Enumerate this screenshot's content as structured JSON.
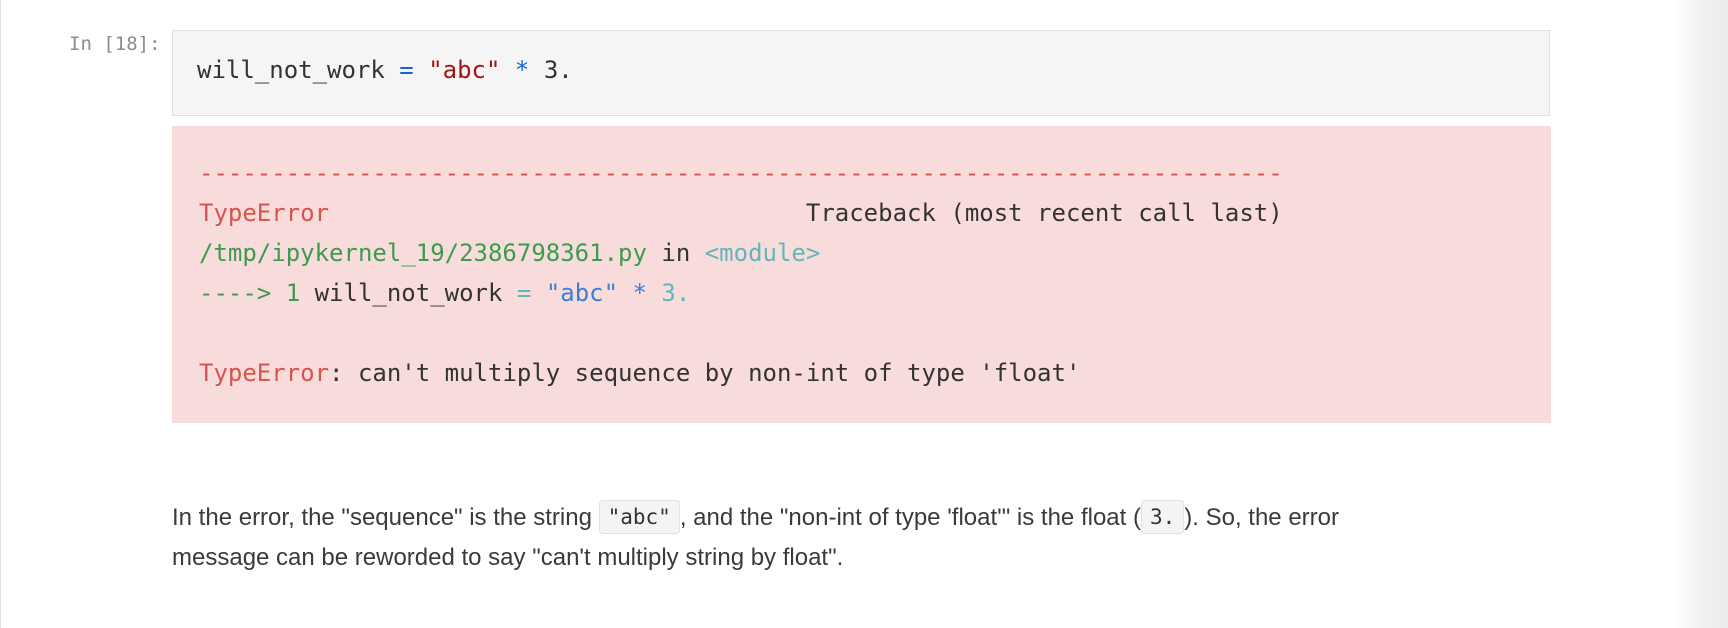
{
  "cell": {
    "prompt": "In [18]:",
    "code": {
      "var": "will_not_work",
      "eq": " = ",
      "str": "\"abc\"",
      "mul": " * ",
      "num": "3."
    }
  },
  "error": {
    "separator": "---------------------------------------------------------------------------",
    "line1": {
      "type": "TypeError",
      "traceback": "                                 Traceback (most recent call last)"
    },
    "line2": {
      "file": "/tmp/ipykernel_19/2386798361.py",
      "in": " in ",
      "module": "<module>"
    },
    "line3": {
      "arrow": "----> 1",
      "var": " will_not_work",
      "eq": " = ",
      "str": "\"abc\"",
      "mul": " * ",
      "num": "3."
    },
    "line4": {
      "type": "TypeError",
      "message": ": can't multiply sequence by non-int of type 'float'"
    }
  },
  "markdown": {
    "p1_before": "In the error, the \"sequence\" is the string ",
    "p1_code1": "\"abc\"",
    "p1_mid": ", and the \"non-int of type 'float'\" is the float (",
    "p1_code2": "3.",
    "p1_after": "). So, the error",
    "p2": "message can be reworded to say \"can't multiply string by float\"."
  },
  "colors": {
    "error_background": "#f8dcdc",
    "string_red": "#a31515",
    "operator_blue": "#1f5fd6",
    "traceback_red": "#d9544f",
    "traceback_green": "#3d9b4d",
    "traceback_cyan": "#62b6bb"
  }
}
